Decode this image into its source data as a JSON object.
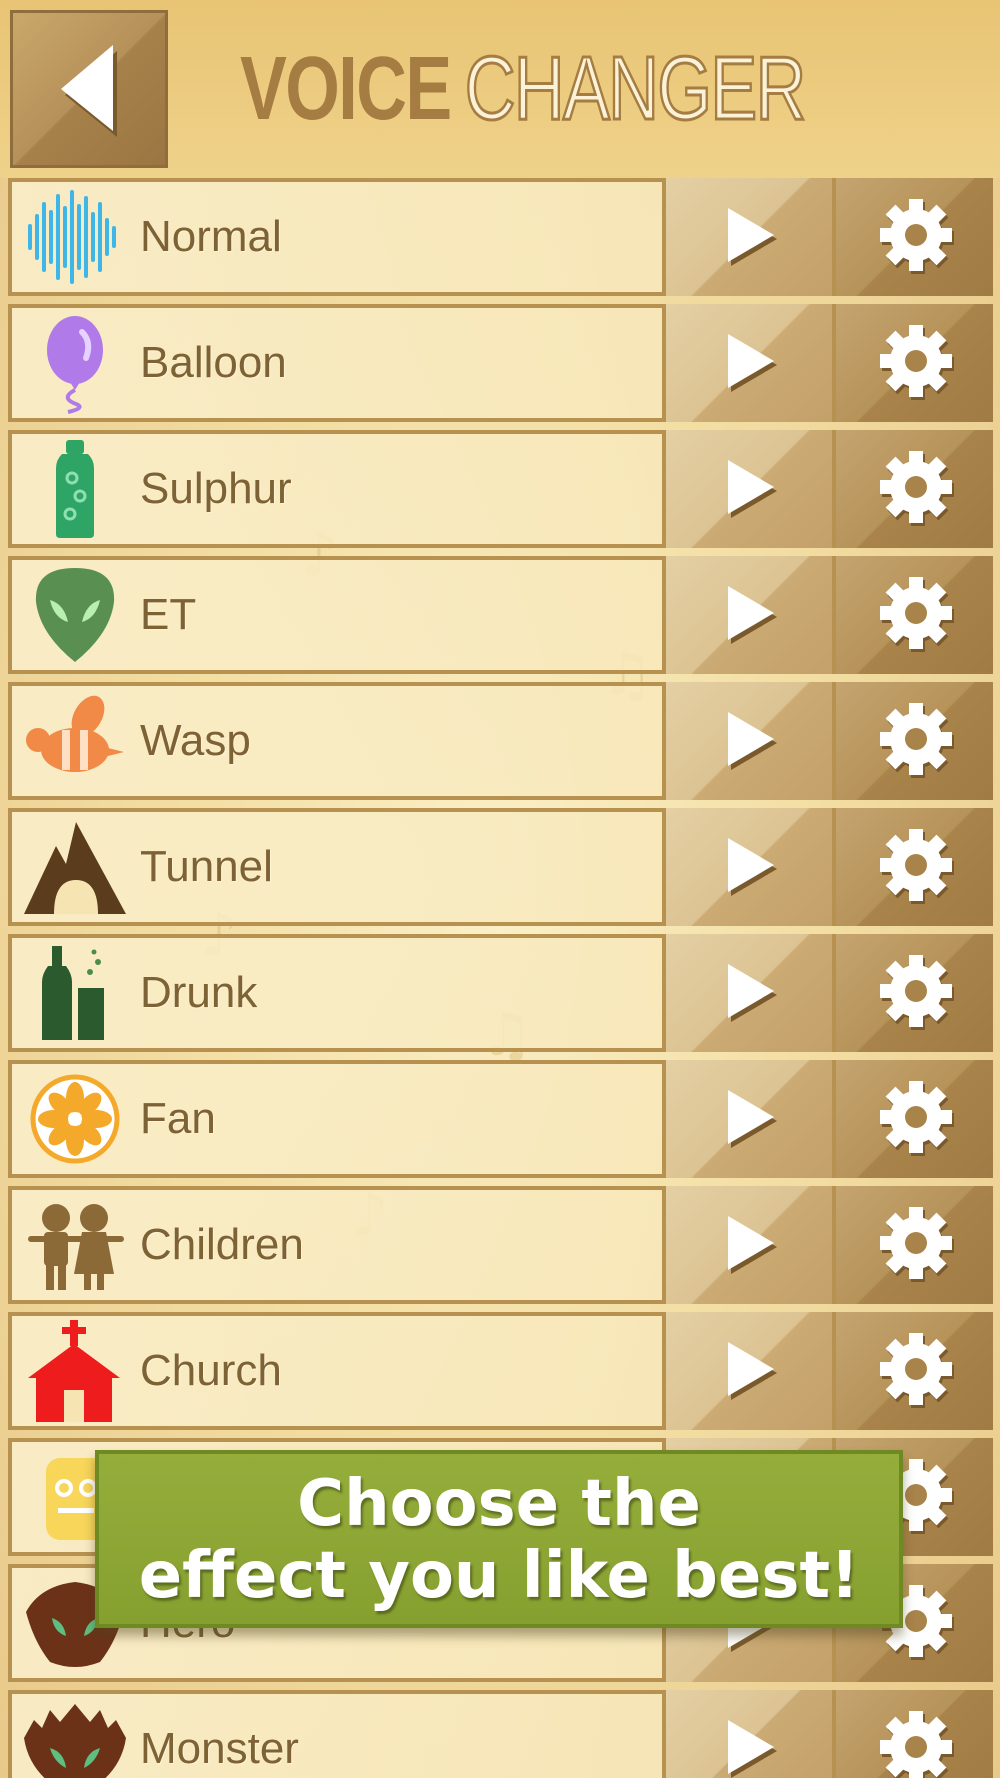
{
  "header": {
    "back_icon": "back-arrow-icon",
    "title_bold": "VOICE",
    "title_outline": "CHANGER"
  },
  "effects": [
    {
      "label": "Normal",
      "icon": "waveform-icon"
    },
    {
      "label": "Balloon",
      "icon": "balloon-icon"
    },
    {
      "label": "Sulphur",
      "icon": "bottle-icon"
    },
    {
      "label": "ET",
      "icon": "alien-icon"
    },
    {
      "label": "Wasp",
      "icon": "wasp-icon"
    },
    {
      "label": "Tunnel",
      "icon": "tunnel-icon"
    },
    {
      "label": "Drunk",
      "icon": "bottle-glass-icon"
    },
    {
      "label": "Fan",
      "icon": "fan-icon"
    },
    {
      "label": "Children",
      "icon": "children-icon"
    },
    {
      "label": "Church",
      "icon": "church-icon"
    },
    {
      "label": "",
      "icon": "robot-icon"
    },
    {
      "label": "Hero",
      "icon": "hero-icon"
    },
    {
      "label": "Monster",
      "icon": "monster-icon"
    }
  ],
  "toast": {
    "line1": "Choose the",
    "line2": "effect you like best!"
  },
  "colors": {
    "accent": "#a57c42",
    "toast_green": "#8aa333",
    "row_border": "#b69150"
  }
}
